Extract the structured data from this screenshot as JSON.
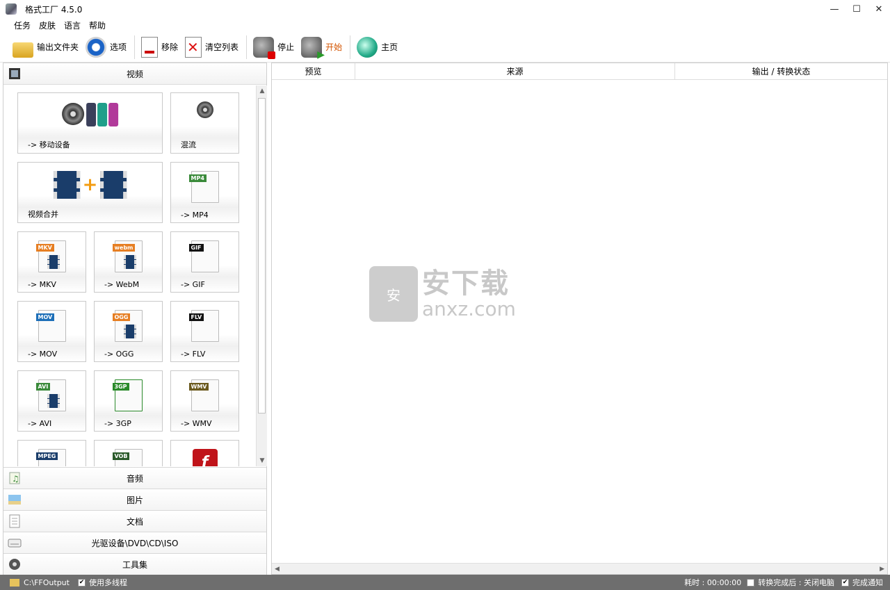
{
  "window": {
    "title": "格式工厂 4.5.0",
    "controls": [
      "—",
      "☐",
      "✕"
    ]
  },
  "menu": [
    "任务",
    "皮肤",
    "语言",
    "帮助"
  ],
  "toolbar": {
    "output_folder": "输出文件夹",
    "options": "选项",
    "remove": "移除",
    "clear_list": "清空列表",
    "stop": "停止",
    "start": "开始",
    "home": "主页"
  },
  "left_panel": {
    "active_category": "视频",
    "tiles": [
      {
        "label": "-> 移动设备",
        "icon": "mobile-device-icon"
      },
      {
        "label": "混流",
        "icon": "mux-icon"
      },
      {
        "label": "视频合并",
        "icon": "video-join-icon"
      },
      {
        "label": "-> MP4",
        "icon": "mp4-icon",
        "tag": "MP4"
      },
      {
        "label": "-> MKV",
        "icon": "mkv-icon",
        "tag": "MKV"
      },
      {
        "label": "-> WebM",
        "icon": "webm-icon",
        "tag": "webm"
      },
      {
        "label": "-> GIF",
        "icon": "gif-icon",
        "tag": "GIF"
      },
      {
        "label": "-> MOV",
        "icon": "mov-icon",
        "tag": "MOV"
      },
      {
        "label": "-> OGG",
        "icon": "ogg-icon",
        "tag": "OGG"
      },
      {
        "label": "-> FLV",
        "icon": "flv-icon",
        "tag": "FLV"
      },
      {
        "label": "-> AVI",
        "icon": "avi-icon",
        "tag": "AVI"
      },
      {
        "label": "-> 3GP",
        "icon": "3gp-icon",
        "tag": "3GP"
      },
      {
        "label": "-> WMV",
        "icon": "wmv-icon",
        "tag": "WMV"
      },
      {
        "label": "",
        "icon": "mpeg-icon",
        "tag": "MPEG"
      },
      {
        "label": "",
        "icon": "vob-icon",
        "tag": "VOB"
      },
      {
        "label": "",
        "icon": "swf-icon",
        "tag": "f"
      }
    ],
    "categories": [
      "音频",
      "图片",
      "文档",
      "光驱设备\\DVD\\CD\\ISO",
      "工具集"
    ]
  },
  "right_panel": {
    "columns": [
      "预览",
      "来源",
      "输出 / 转换状态"
    ],
    "watermark_cn": "安下载",
    "watermark_en": "anxz.com",
    "watermark_badge": "安"
  },
  "status": {
    "output_path": "C:\\FFOutput",
    "multithread_label": "使用多线程",
    "multithread_checked": true,
    "elapsed": "耗时 : 00:00:00",
    "after_done_label": "转换完成后 : 关闭电脑",
    "after_done_checked": false,
    "notify_label": "完成通知",
    "notify_checked": true
  },
  "colors": {
    "start_label": "#d35400",
    "statusbar": "#6e6e6e"
  }
}
